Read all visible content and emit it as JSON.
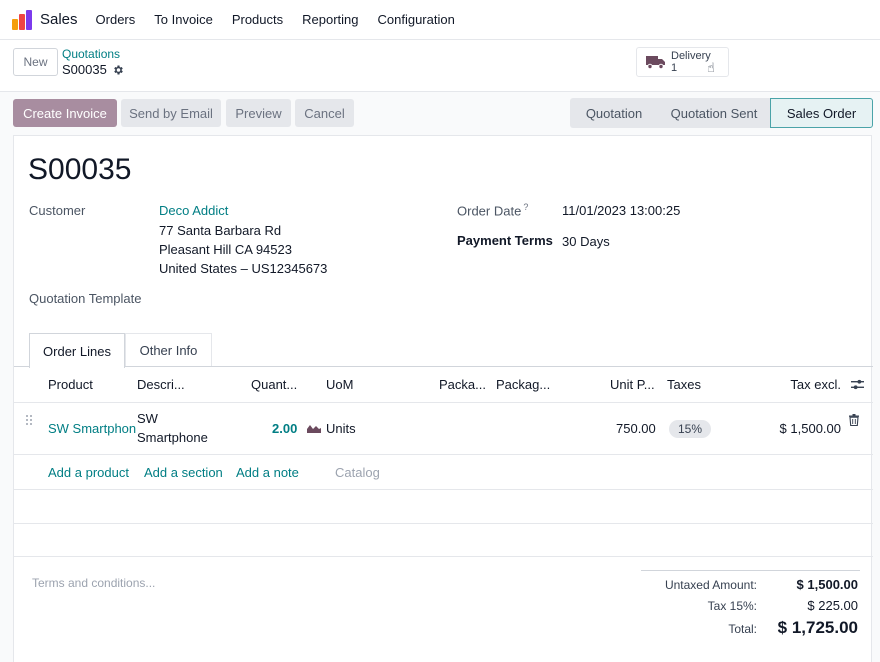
{
  "navbar": {
    "app_name": "Sales",
    "menu": [
      "Orders",
      "To Invoice",
      "Products",
      "Reporting",
      "Configuration"
    ]
  },
  "control": {
    "new_label": "New",
    "breadcrumb_parent": "Quotations",
    "breadcrumb_current": "S00035",
    "smart_button": {
      "label": "Delivery",
      "value": "1"
    }
  },
  "actions": {
    "create_invoice": "Create Invoice",
    "send_email": "Send by Email",
    "preview": "Preview",
    "cancel": "Cancel"
  },
  "stages": [
    "Quotation",
    "Quotation Sent",
    "Sales Order"
  ],
  "form": {
    "name": "S00035",
    "customer_label": "Customer",
    "customer_name": "Deco Addict",
    "address_line1": "77 Santa Barbara Rd",
    "address_line2": "Pleasant Hill CA 94523",
    "address_line3": "United States – US12345673",
    "order_date_label": "Order Date",
    "order_date_help": "?",
    "order_date": "11/01/2023 13:00:25",
    "payment_terms_label": "Payment Terms",
    "payment_terms": "30 Days",
    "quotation_template_label": "Quotation Template"
  },
  "tabs": [
    "Order Lines",
    "Other Info"
  ],
  "table": {
    "headers": [
      "Product",
      "Descri...",
      "Quant...",
      "UoM",
      "Packa...",
      "Packag...",
      "Unit P...",
      "Taxes",
      "Tax excl."
    ],
    "row": {
      "product": "SW Smartphon",
      "description_line1": "SW",
      "description_line2": "Smartphone",
      "quantity": "2.00",
      "uom": "Units",
      "unit_price": "750.00",
      "tax": "15%",
      "subtotal": "$ 1,500.00"
    },
    "add_product": "Add a product",
    "add_section": "Add a section",
    "add_note": "Add a note",
    "catalog": "Catalog"
  },
  "footer": {
    "terms_placeholder": "Terms and conditions...",
    "untaxed_label": "Untaxed Amount:",
    "untaxed_value": "$ 1,500.00",
    "tax_label": "Tax 15%:",
    "tax_value": "$ 225.00",
    "total_label": "Total:",
    "total_value": "$ 1,725.00"
  },
  "colors": {
    "primary": "#a88da0",
    "link": "#017e84"
  }
}
